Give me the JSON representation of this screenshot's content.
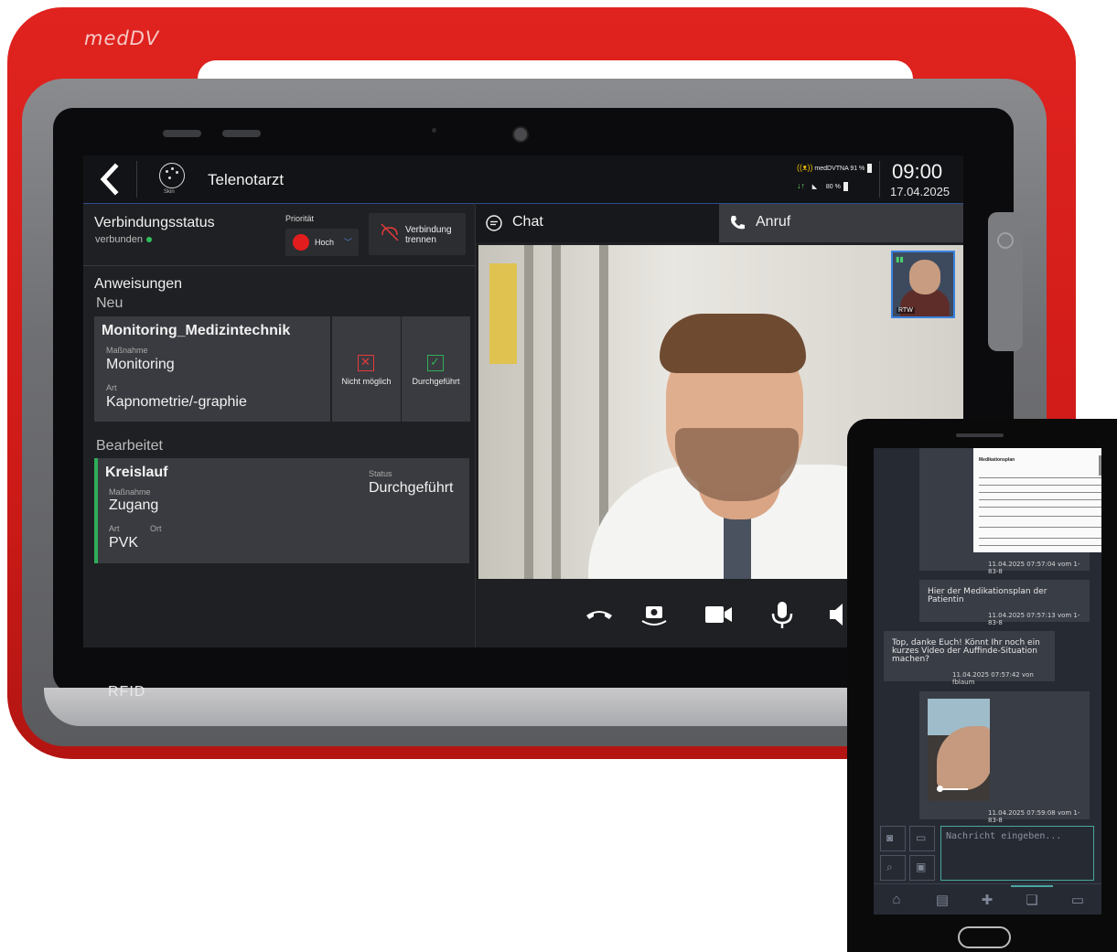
{
  "tablet": {
    "brand": "medDV",
    "rfid": "RFID",
    "header": {
      "skin_label": "Skin",
      "title": "Telenotarzt",
      "network_name": "medDVTNA",
      "signal_pct": "91 %",
      "battery_pct": "80 %",
      "time": "09:00",
      "date": "17.04.2025"
    },
    "connection": {
      "label": "Verbindungsstatus",
      "status": "verbunden",
      "priority_label": "Priorität",
      "priority_value": "Hoch",
      "disconnect_line1": "Verbindung",
      "disconnect_line2": "trennen"
    },
    "instructions": {
      "title": "Anweisungen",
      "new_label": "Neu",
      "new_item": {
        "title": "Monitoring_Medizintechnik",
        "measure_label": "Maßnahme",
        "measure": "Monitoring",
        "type_label": "Art",
        "type": "Kapnometrie/-graphie",
        "not_possible": "Nicht möglich",
        "done": "Durchgeführt"
      },
      "processed_label": "Bearbeitet",
      "processed_item": {
        "title": "Kreislauf",
        "measure_label": "Maßnahme",
        "measure": "Zugang",
        "type_label": "Art",
        "location_label": "Ort",
        "type": "PVK",
        "status_label": "Status",
        "status": "Durchgeführt"
      }
    },
    "tabs": {
      "chat": "Chat",
      "call": "Anruf"
    },
    "pip_label": "RTW"
  },
  "phone": {
    "messages": [
      {
        "doc_title": "Medikationsplan",
        "time": "11.04.2025 07:57:04 vom 1-83-8"
      },
      {
        "text_line1": "Hier der Medikationsplan der",
        "text_line2": "Patientin",
        "time": "11.04.2025 07:57:13 vom 1-83-8"
      },
      {
        "text_line1": "Top, danke Euch! Könnt Ihr noch ein",
        "text_line2": "kurzes Video der Auffinde-Situation",
        "text_line3": "machen?",
        "time": "11.04.2025 07:57:42 von fblaum"
      },
      {
        "time": "11.04.2025 07:59:08 vom 1-83-8"
      }
    ],
    "input_placeholder": "Nachricht eingeben...",
    "colors": {
      "accent": "#4aa7a0"
    }
  },
  "colors": {
    "device_red": "#d91f1c",
    "status_green": "#2fbf5a",
    "priority_red": "#e21d1d"
  }
}
